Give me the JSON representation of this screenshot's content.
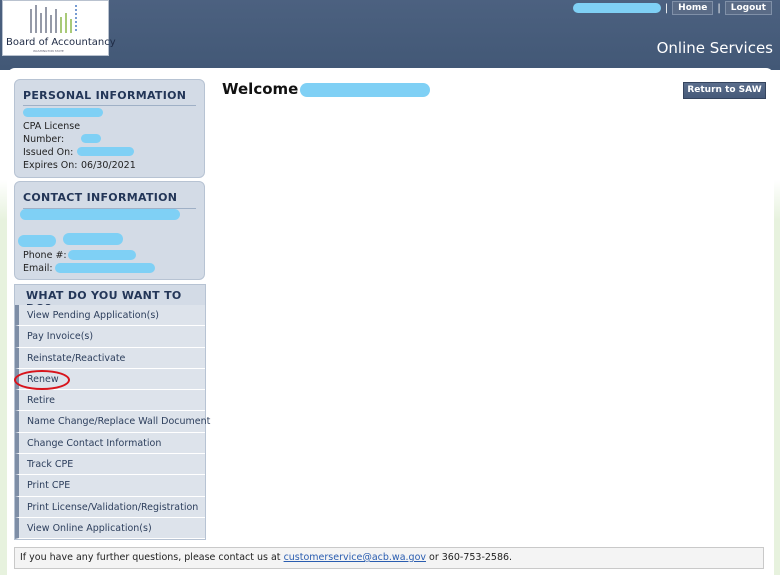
{
  "header": {
    "logo_text": "Board of Accountancy",
    "logo_tagline": "WASHINGTON STATE",
    "home_label": "Home",
    "logout_label": "Logout",
    "separator": "|",
    "section_title": "Online Services"
  },
  "personal": {
    "title": "PERSONAL INFORMATION",
    "license_line1": "CPA License",
    "license_line2": "Number:",
    "issued_label": "Issued On:",
    "expires_label": "Expires On:",
    "expires_value": "06/30/2021"
  },
  "contact": {
    "title": "CONTACT INFORMATION",
    "phone_label": "Phone #:",
    "email_label": "Email:"
  },
  "menu": {
    "title": "WHAT DO YOU WANT TO DO?",
    "items": [
      "View Pending Application(s)",
      "Pay Invoice(s)",
      "Reinstate/Reactivate",
      "Renew",
      "Retire",
      "Name Change/Replace Wall Document",
      "Change Contact Information",
      "Track CPE",
      "Print CPE",
      "Print License/Validation/Registration",
      "View Online Application(s)"
    ]
  },
  "main": {
    "welcome": "Welcome",
    "return_label": "Return to SAW"
  },
  "footer": {
    "text_before": "If you have any further questions, please contact us at ",
    "email": "customerservice@acb.wa.gov",
    "text_after": " or 360-753-2586."
  },
  "colors": {
    "header_bg": "#4c6180",
    "panel_bg": "#d3dbe6",
    "title_text": "#233658",
    "annotation_circle": "#d8141c",
    "redaction": "#7fd0f5"
  }
}
